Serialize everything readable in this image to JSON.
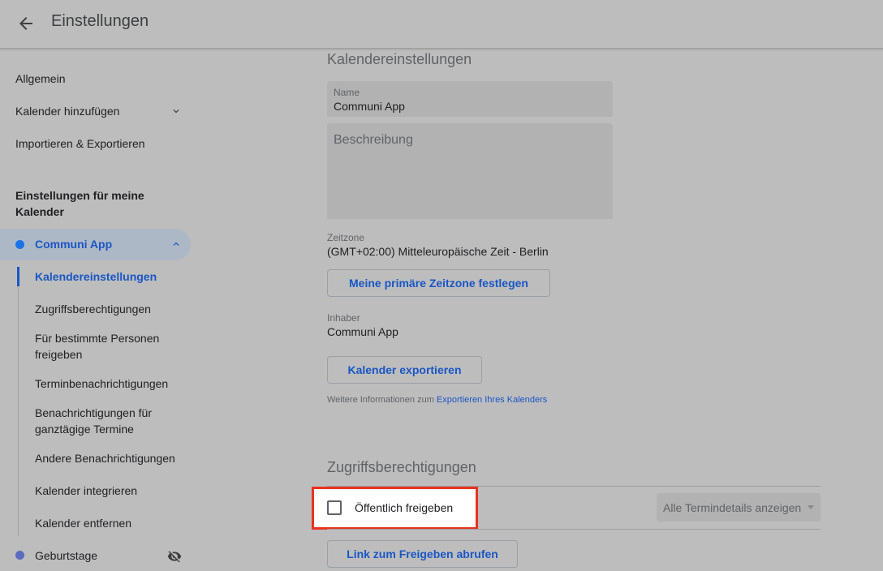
{
  "header": {
    "title": "Einstellungen"
  },
  "sidebar": {
    "items": [
      {
        "label": "Allgemein"
      },
      {
        "label": "Kalender hinzufügen"
      },
      {
        "label": "Importieren & Exportieren"
      }
    ],
    "section_heading": "Einstellungen für meine Kalender",
    "calendar": {
      "name": "Communi App",
      "color": "#1a73e8",
      "subitems": [
        {
          "label": "Kalendereinstellungen"
        },
        {
          "label": "Zugriffsberechtigungen"
        },
        {
          "label": "Für bestimmte Personen freigeben"
        },
        {
          "label": "Terminbenachrichtigungen"
        },
        {
          "label": "Benachrichtigungen für ganztägige Termine"
        },
        {
          "label": "Andere Benachrichtigungen"
        },
        {
          "label": "Kalender integrieren"
        },
        {
          "label": "Kalender entfernen"
        }
      ]
    },
    "other_calendar": {
      "name": "Geburtstage",
      "color": "#5c6bc0"
    }
  },
  "main": {
    "calendar_settings": {
      "heading": "Kalendereinstellungen",
      "name_label": "Name",
      "name_value": "Communi App",
      "description_placeholder": "Beschreibung",
      "timezone_label": "Zeitzone",
      "timezone_value": "(GMT+02:00) Mitteleuropäische Zeit - Berlin",
      "timezone_button": "Meine primäre Zeitzone festlegen",
      "owner_label": "Inhaber",
      "owner_value": "Communi App",
      "export_button": "Kalender exportieren",
      "info_prefix": "Weitere Informationen zum",
      "info_link": "Exportieren Ihres Kalenders"
    },
    "access": {
      "heading": "Zugriffsberechtigungen",
      "public_checkbox_label": "Öffentlich freigeben",
      "public_checked": false,
      "details_dropdown": "Alle Termindetails anzeigen",
      "link_button": "Link zum Freigeben abrufen"
    }
  },
  "colors": {
    "accent": "#1a56c4",
    "highlight": "#e8321f"
  }
}
